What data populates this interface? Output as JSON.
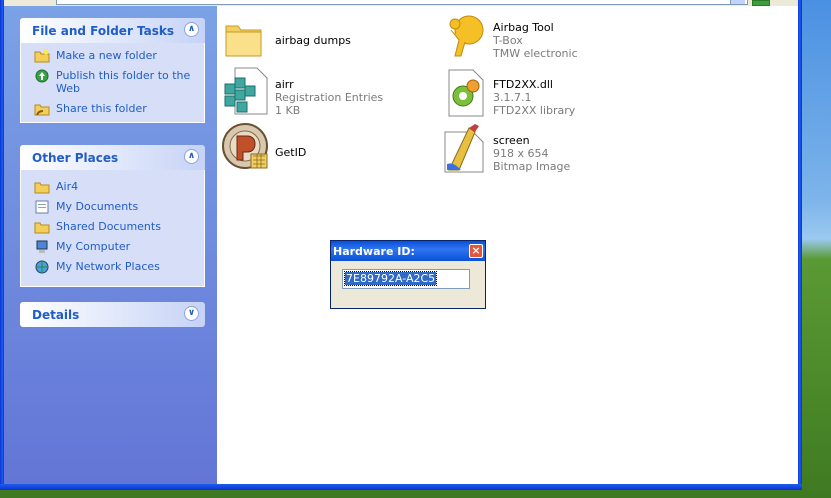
{
  "colors": {
    "task_link": "#215dc6",
    "panel_title": "#215dc6",
    "dialog_title_bar": "#0a50d8",
    "selection": "#316ac5",
    "sidepane_top": "#7ba2e7",
    "sidepane_bottom": "#6375d6"
  },
  "sidebar": {
    "file_folder_tasks": {
      "title": "File and Folder Tasks",
      "items": [
        {
          "label": "Make a new folder",
          "icon": "new-folder-icon"
        },
        {
          "label": "Publish this folder to the Web",
          "icon": "publish-web-icon"
        },
        {
          "label": "Share this folder",
          "icon": "share-folder-icon"
        }
      ]
    },
    "other_places": {
      "title": "Other Places",
      "items": [
        {
          "label": "Air4",
          "icon": "folder-icon"
        },
        {
          "label": "My Documents",
          "icon": "my-documents-icon"
        },
        {
          "label": "Shared Documents",
          "icon": "shared-folder-icon"
        },
        {
          "label": "My Computer",
          "icon": "my-computer-icon"
        },
        {
          "label": "My Network Places",
          "icon": "network-places-icon"
        }
      ]
    },
    "details": {
      "title": "Details"
    }
  },
  "files": [
    {
      "name": "airbag dumps",
      "line2": "",
      "line3": "",
      "icon": "folder-icon"
    },
    {
      "name": "Airbag Tool",
      "line2": "T-Box",
      "line3": "TMW electronic",
      "icon": "airbag-app-icon"
    },
    {
      "name": "airr",
      "line2": "Registration Entries",
      "line3": "1 KB",
      "icon": "registry-file-icon"
    },
    {
      "name": "FTD2XX.dll",
      "line2": "3.1.7.1",
      "line3": "FTD2XX library",
      "icon": "dll-icon"
    },
    {
      "name": "GetID",
      "line2": "",
      "line3": "",
      "icon": "getid-app-icon"
    },
    {
      "name": "screen",
      "line2": "918 x 654",
      "line3": "Bitmap Image",
      "icon": "bitmap-icon"
    }
  ],
  "dialog": {
    "title": "Hardware ID:",
    "value": "7E89792A-A2C5"
  }
}
